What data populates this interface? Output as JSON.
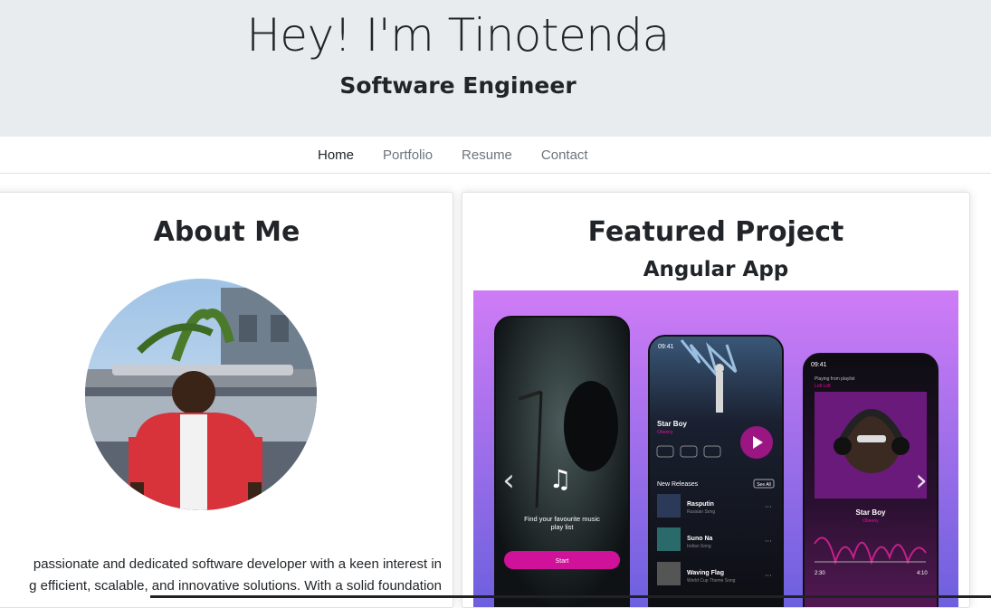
{
  "hero": {
    "title": "Hey! I'm Tinotenda",
    "subtitle": "Software Engineer"
  },
  "nav": {
    "items": [
      {
        "label": "Home",
        "active": true
      },
      {
        "label": "Portfolio",
        "active": false
      },
      {
        "label": "Resume",
        "active": false
      },
      {
        "label": "Contact",
        "active": false
      }
    ]
  },
  "about": {
    "title": "About Me",
    "avatar_icon": "profile-photo",
    "bio_line1": "passionate and dedicated software developer with a keen interest in",
    "bio_line2": "g efficient, scalable, and innovative solutions. With a solid foundation"
  },
  "project": {
    "title": "Featured Project",
    "subtitle": "Angular App",
    "carousel_prev_icon": "chevron-left-icon",
    "carousel_next_icon": "chevron-right-icon",
    "mockup": {
      "screen1_text": "Find your favourite music play list",
      "screen1_button": "Start",
      "screen2_time": "09:41",
      "screen2_song": "Star Boy",
      "screen2_artist": "Obeeny",
      "screen2_section": "New Releases",
      "screen2_see_all": "See All",
      "screen2_tracks": [
        {
          "title": "Rasputin",
          "sub": "Russian Song"
        },
        {
          "title": "Suno Na",
          "sub": "Indian Song"
        },
        {
          "title": "Waving Flag",
          "sub": "World Cup Theme Song"
        }
      ],
      "screen3_time": "09:41",
      "screen3_playing": "Playing from playlist",
      "screen3_playlist": "Lofi Loft",
      "screen3_song": "Star Boy",
      "screen3_artist": "Obeeny",
      "screen3_start": "2:30",
      "screen3_end": "4:10"
    }
  }
}
